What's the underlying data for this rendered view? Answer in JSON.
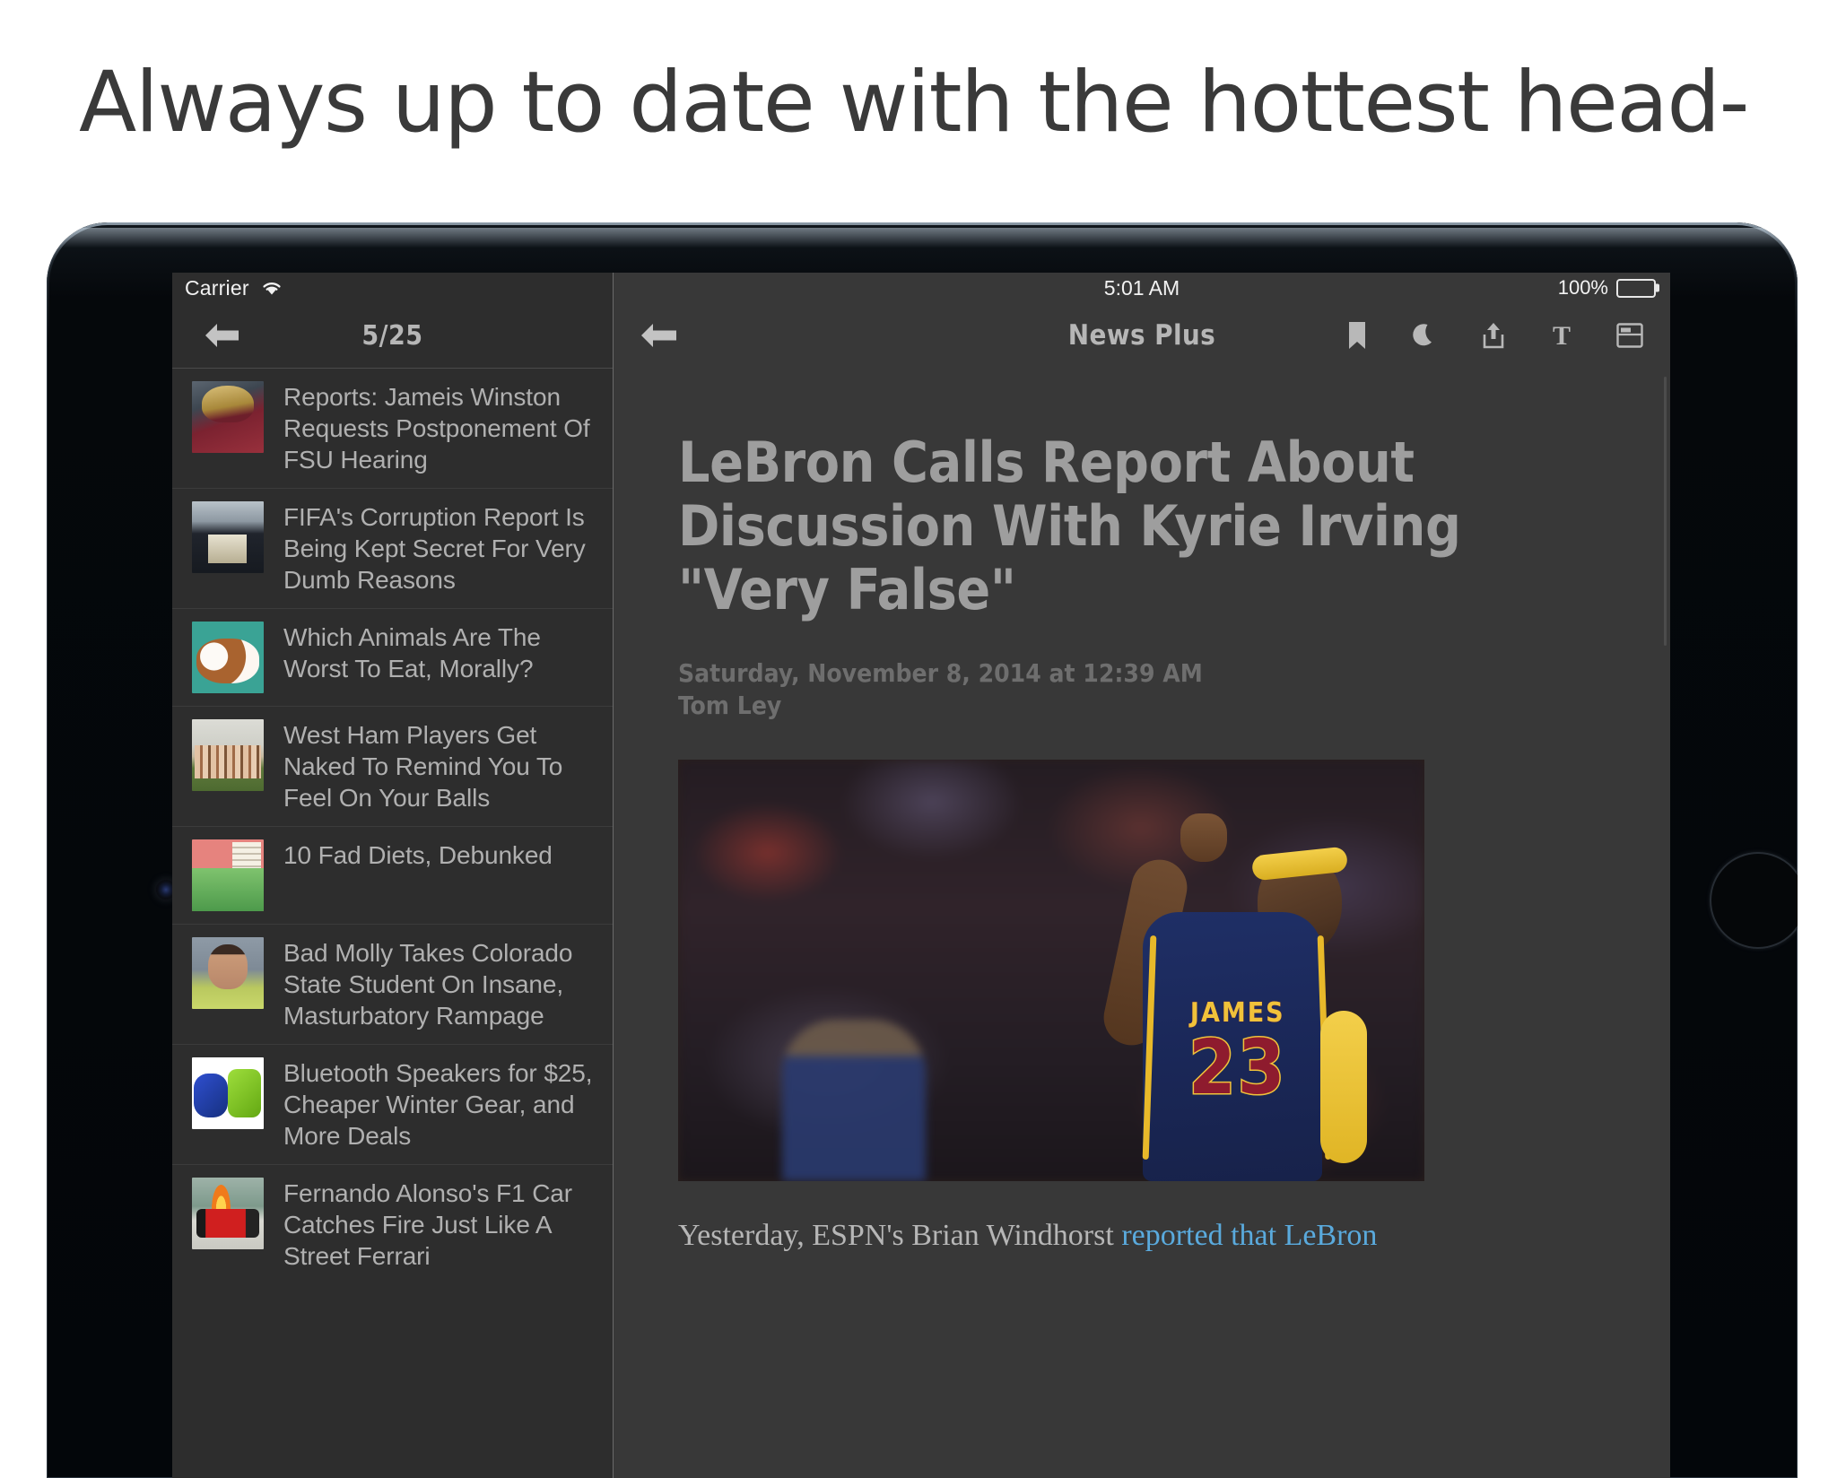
{
  "promo": {
    "headline": "Always up to date with the hottest head-"
  },
  "device": {
    "camera_icon": "front-camera",
    "home_button": "home-button"
  },
  "sidebar": {
    "status": {
      "carrier": "Carrier",
      "wifi_icon": "wifi-icon"
    },
    "nav": {
      "back_icon": "arrow-left-icon",
      "counter": "5/25"
    },
    "items": [
      {
        "title": "Reports: Jameis Winston Requests Postponement Of FSU Hearing",
        "thumb": "th-winston"
      },
      {
        "title": "FIFA's Corruption Report Is Being Kept Secret For Very Dumb Reasons",
        "thumb": "th-fifa"
      },
      {
        "title": "Which Animals Are The Worst To Eat, Morally?",
        "thumb": "th-puppies"
      },
      {
        "title": "West Ham Players Get Naked To Remind You To Feel On Your Balls",
        "thumb": "th-westham"
      },
      {
        "title": "10 Fad Diets, Debunked",
        "thumb": "th-diets"
      },
      {
        "title": "Bad Molly Takes Colorado State Student On Insane, Masturbatory Rampage",
        "thumb": "th-molly"
      },
      {
        "title": "Bluetooth Speakers for $25, Cheaper Winter Gear, and More Deals",
        "thumb": "th-speakers"
      },
      {
        "title": "Fernando Alonso's F1 Car Catches Fire Just Like A Street Ferrari",
        "thumb": "th-ferrari"
      }
    ]
  },
  "reader": {
    "status": {
      "time": "5:01 AM",
      "battery_percent": "100%",
      "battery_icon": "battery-full-icon"
    },
    "nav": {
      "back_icon": "arrow-left-icon",
      "title": "News Plus",
      "tools": [
        {
          "name": "bookmark-icon",
          "label": "Bookmark"
        },
        {
          "name": "moon-icon",
          "label": "Night Mode"
        },
        {
          "name": "share-icon",
          "label": "Share"
        },
        {
          "name": "text-size-icon",
          "label": "Text Size"
        },
        {
          "name": "reader-view-icon",
          "label": "Reader View"
        }
      ]
    },
    "article": {
      "headline": "LeBron Calls Report About Discussion With Kyrie Irving \"Very False\"",
      "date": "Saturday, November 8, 2014 at 12:39 AM",
      "author": "Tom Ley",
      "photo": {
        "name": "lebron-james-photo",
        "jersey_name": "JAMES",
        "jersey_number": "23"
      },
      "body_lead": "Yesterday, ESPN's Brian Windhorst ",
      "body_link": "reported that LeBron"
    }
  },
  "colors": {
    "screen_bg": "#1e1e1e",
    "sidebar_bg": "#2d2d2d",
    "reader_bg": "#383838",
    "text_primary": "#b0b0b0",
    "text_muted": "#6e6e6e",
    "link": "#5aaadd",
    "accent_gold": "#e8b92a",
    "jersey_blue": "#1f2f66"
  }
}
